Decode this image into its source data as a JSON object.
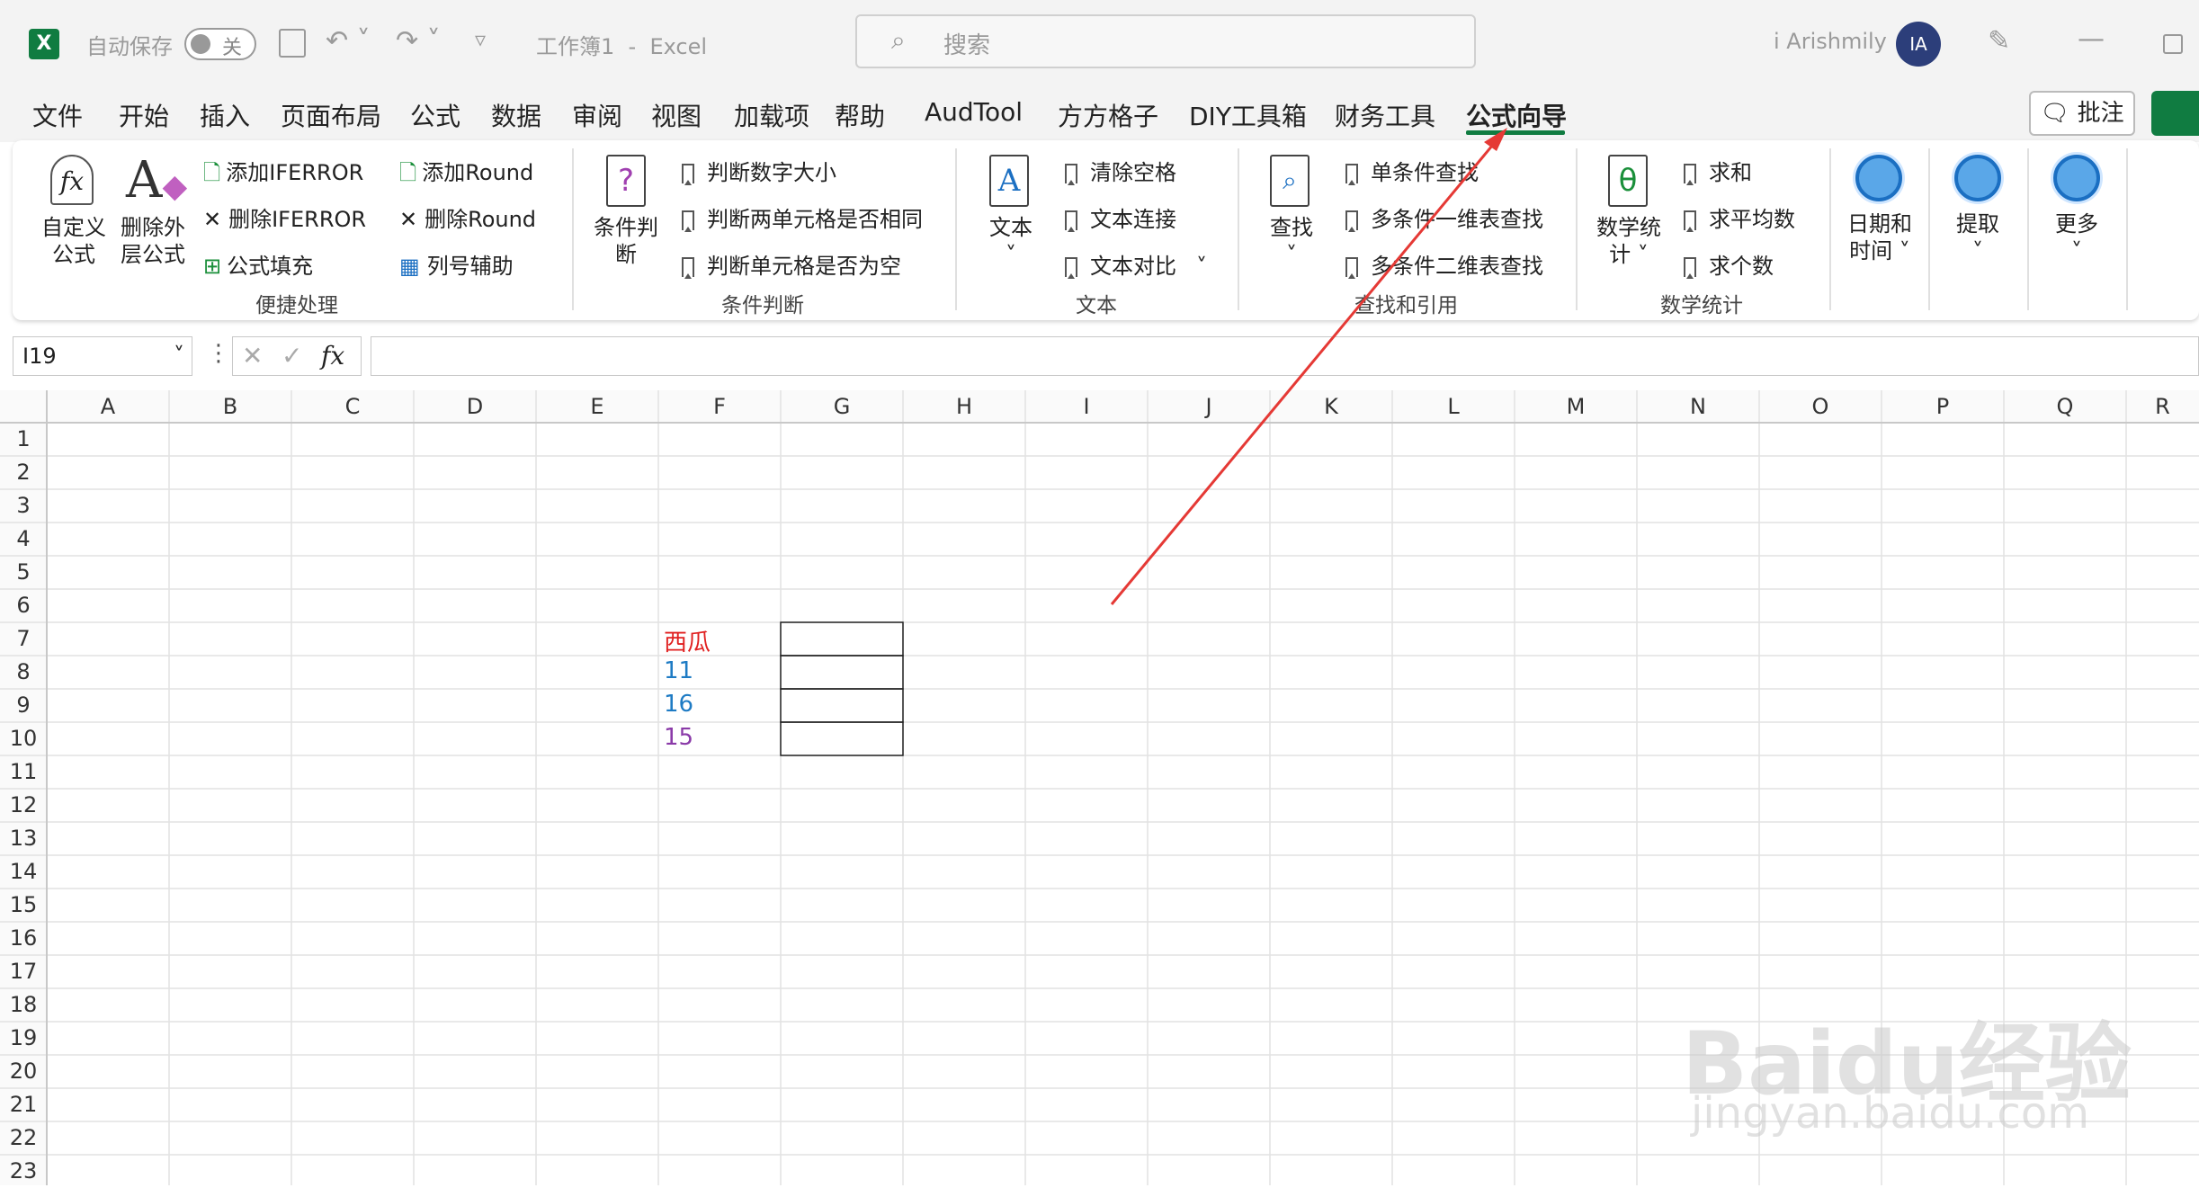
{
  "titlebar": {
    "autosave_label": "自动保存",
    "toggle_state": "关",
    "doc_title": "工作簿1  -  Excel",
    "search_placeholder": "搜索",
    "user_name": "i Arishmily",
    "user_initials": "IA"
  },
  "menu": {
    "tabs": [
      "文件",
      "开始",
      "插入",
      "页面布局",
      "公式",
      "数据",
      "审阅",
      "视图",
      "加载项",
      "帮助",
      "AudTool",
      "方方格子",
      "DIY工具箱",
      "财务工具",
      "公式向导"
    ],
    "active": "公式向导",
    "comment_button": "批注"
  },
  "ribbon": {
    "quick": {
      "custom_formula": "自定义\n公式",
      "remove_outer": "删除外\n层公式",
      "add_iferror": "添加IFERROR",
      "del_iferror": "删除IFERROR",
      "formula_fill": "公式填充",
      "add_round": "添加Round",
      "del_round": "删除Round",
      "col_assist": "列号辅助",
      "group_label": "便捷处理"
    },
    "condition": {
      "big": "条件判\n断",
      "item1": "判断数字大小",
      "item2": "判断两单元格是否相同",
      "item3": "判断单元格是否为空",
      "group_label": "条件判断"
    },
    "text": {
      "big": "文本",
      "item1": "清除空格",
      "item2": "文本连接",
      "item3": "文本对比",
      "group_label": "文本"
    },
    "lookup": {
      "big": "查找",
      "item1": "单条件查找",
      "item2": "多条件一维表查找",
      "item3": "多条件二维表查找",
      "group_label": "查找和引用"
    },
    "math": {
      "big": "数学统\n计",
      "item1": "求和",
      "item2": "求平均数",
      "item3": "求个数",
      "group_label": "数学统计"
    },
    "datetime": "日期和\n时间",
    "extract": "提取",
    "more": "更多"
  },
  "formula_bar": {
    "name_box": "I19",
    "fx": "fx",
    "value": ""
  },
  "sheet": {
    "columns": [
      "A",
      "B",
      "C",
      "D",
      "E",
      "F",
      "G",
      "H",
      "I",
      "J",
      "K",
      "L",
      "M",
      "N",
      "O",
      "P",
      "Q",
      "R"
    ],
    "rows": [
      "1",
      "2",
      "3",
      "4",
      "5",
      "6",
      "7",
      "8",
      "9",
      "10",
      "11",
      "12",
      "13",
      "14",
      "15",
      "16",
      "17",
      "18",
      "19",
      "20",
      "21",
      "22",
      "23"
    ],
    "cells": {
      "F7": {
        "value": "西瓜",
        "color": "#e02020"
      },
      "F8": {
        "value": "11",
        "color": "#1e7bc4"
      },
      "F9": {
        "value": "16",
        "color": "#1e7bc4"
      },
      "F10": {
        "value": "15",
        "color": "#8a3aa8"
      }
    }
  },
  "watermark": {
    "line1": "Baidu经验",
    "line2": "jingyan.baidu.com"
  },
  "colors": {
    "excel_green": "#107c41",
    "arrow_red": "#e53935",
    "accent_blue": "#1b6fc2"
  }
}
